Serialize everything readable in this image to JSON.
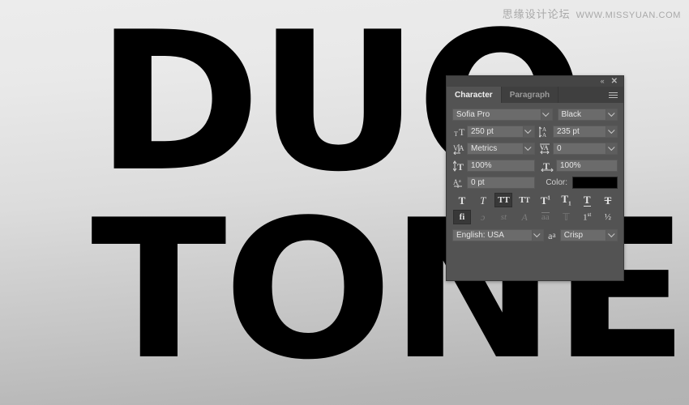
{
  "watermark": {
    "chinese": "思缘设计论坛",
    "url": "WWW.MISSYUAN.COM"
  },
  "artwork": {
    "line1": "DUO",
    "line2": "TONE",
    "text_color": "#000000",
    "background_top": "#ececec",
    "background_bottom": "#b3b3b3"
  },
  "panel": {
    "titlebar": {
      "collapse_icon": "«",
      "close_icon": "✕"
    },
    "tabs": [
      {
        "label": "Character",
        "active": true
      },
      {
        "label": "Paragraph",
        "active": false
      }
    ],
    "font": {
      "family_value": "Sofia Pro",
      "style_value": "Black"
    },
    "metrics": {
      "size_icon": "font-size-icon",
      "size_value": "250 pt",
      "leading_icon": "leading-icon",
      "leading_value": "235 pt",
      "kerning_icon": "kerning-icon",
      "kerning_value": "Metrics",
      "tracking_icon": "tracking-icon",
      "tracking_value": "0",
      "vertical_scale_icon": "vertical-scale-icon",
      "vertical_scale_value": "100%",
      "horizontal_scale_icon": "horizontal-scale-icon",
      "horizontal_scale_value": "100%",
      "baseline_shift_icon": "baseline-shift-icon",
      "baseline_shift_value": "0 pt",
      "color_label": "Color:",
      "color_value": "#000000"
    },
    "style_buttons": [
      {
        "name": "faux-bold",
        "glyph": "T",
        "active": false,
        "dim": false
      },
      {
        "name": "faux-italic",
        "glyph": "T",
        "active": false,
        "dim": false
      },
      {
        "name": "all-caps",
        "glyph": "TT",
        "active": true,
        "dim": false
      },
      {
        "name": "small-caps",
        "glyph": "TT",
        "active": false,
        "dim": false
      },
      {
        "name": "superscript",
        "glyph": "T1",
        "active": false,
        "dim": false
      },
      {
        "name": "subscript",
        "glyph": "T1",
        "active": false,
        "dim": false
      },
      {
        "name": "underline",
        "glyph": "T",
        "active": false,
        "dim": false
      },
      {
        "name": "strikethrough",
        "glyph": "T",
        "active": false,
        "dim": false
      }
    ],
    "opentype_buttons": [
      {
        "name": "standard-ligatures",
        "glyph": "fi",
        "active": true,
        "dim": false
      },
      {
        "name": "contextual-alternates",
        "glyph": "ɔ",
        "active": false,
        "dim": true
      },
      {
        "name": "discretionary-ligatures",
        "glyph": "st",
        "active": false,
        "dim": true
      },
      {
        "name": "swash",
        "glyph": "A",
        "active": false,
        "dim": true
      },
      {
        "name": "stylistic-alternates",
        "glyph": "aa",
        "active": false,
        "dim": true
      },
      {
        "name": "titling-alternates",
        "glyph": "T",
        "active": false,
        "dim": true
      },
      {
        "name": "ordinals",
        "glyph": "1st",
        "active": false,
        "dim": false
      },
      {
        "name": "fractions",
        "glyph": "½",
        "active": false,
        "dim": false
      }
    ],
    "bottom": {
      "language_value": "English: USA",
      "antialias_icon": "aa-icon",
      "antialias_value": "Crisp"
    }
  }
}
